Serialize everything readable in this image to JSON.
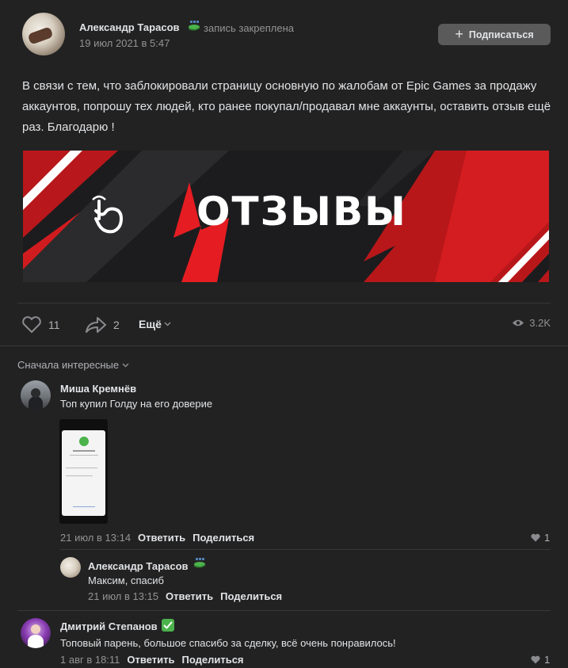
{
  "post": {
    "author": "Александр Тарасов",
    "pinned_label": "запись закреплена",
    "date": "19 июл 2021 в 5:47",
    "subscribe_label": "Подписаться",
    "text": "В связи с тем, что заблокировали страницу основную по жалобам от Epic Games за продажу аккаунтов, попрошу тех людей, кто ранее покупал/продавал мне аккаунты, оставить отзыв ещё раз. Благодарю !",
    "banner_text": "ОТЗЫВЫ",
    "likes": "11",
    "shares": "2",
    "more_label": "Ещё",
    "views": "3.2K"
  },
  "comments_sort": "Сначала интересные",
  "comments": [
    {
      "author": "Миша Кремнёв",
      "text": "Топ купил Голду на его доверие",
      "date": "21 июл в 13:14",
      "reply_label": "Ответить",
      "share_label": "Поделиться",
      "likes": "1"
    },
    {
      "author": "Александр Тарасов",
      "text": "Максим, спасиб",
      "date": "21 июл в 13:15",
      "reply_label": "Ответить",
      "share_label": "Поделиться"
    },
    {
      "author": "Дмитрий Степанов",
      "text": "Топовый парень, большое спасибо за сделку, всё очень понравилось!",
      "date": "1 авг в 18:11",
      "reply_label": "Ответить",
      "share_label": "Поделиться",
      "likes": "1"
    }
  ],
  "colors": {
    "background": "#222222",
    "text": "#e1e3e6",
    "muted": "#939393",
    "banner_red": "#c8171a",
    "verified_green": "#4bb34b"
  },
  "icons": [
    "pin-icon",
    "plus-icon",
    "like-icon",
    "share-icon",
    "chevron-down-icon",
    "eye-icon",
    "pointer-hand-icon",
    "verified-icon"
  ]
}
